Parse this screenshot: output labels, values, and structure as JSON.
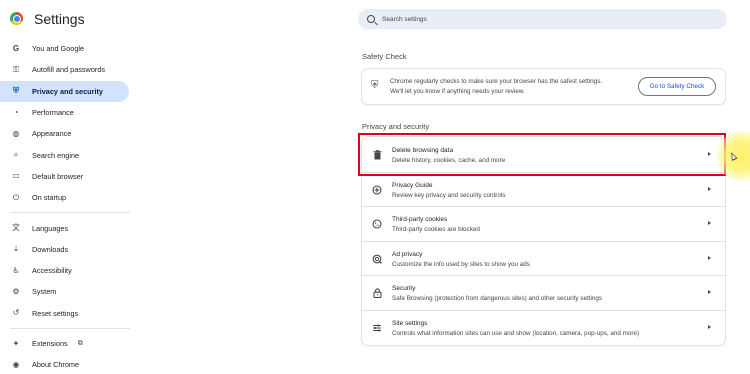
{
  "header": {
    "title": "Settings",
    "search_placeholder": "Search settings"
  },
  "sidebar": {
    "items": [
      {
        "label": "You and Google",
        "icon": "google-g-icon",
        "glyph": "G",
        "active": false
      },
      {
        "label": "Autofill and passwords",
        "icon": "key-icon",
        "glyph": "⚿",
        "active": false
      },
      {
        "label": "Privacy and security",
        "icon": "shield-icon",
        "glyph": "⛨",
        "active": true
      },
      {
        "label": "Performance",
        "icon": "speedometer-icon",
        "glyph": "◔",
        "active": false
      },
      {
        "label": "Appearance",
        "icon": "palette-icon",
        "glyph": "◍",
        "active": false
      },
      {
        "label": "Search engine",
        "icon": "search-icon",
        "glyph": "⌕",
        "active": false
      },
      {
        "label": "Default browser",
        "icon": "browser-window-icon",
        "glyph": "▭",
        "active": false
      },
      {
        "label": "On startup",
        "icon": "power-icon",
        "glyph": "⏻",
        "active": false
      }
    ],
    "items_secondary": [
      {
        "label": "Languages",
        "icon": "translate-icon",
        "glyph": "文",
        "active": false
      },
      {
        "label": "Downloads",
        "icon": "download-icon",
        "glyph": "⤓",
        "active": false
      },
      {
        "label": "Accessibility",
        "icon": "accessibility-icon",
        "glyph": "♿",
        "active": false
      },
      {
        "label": "System",
        "icon": "wrench-icon",
        "glyph": "⚙",
        "active": false
      },
      {
        "label": "Reset settings",
        "icon": "reset-icon",
        "glyph": "↺",
        "active": false
      }
    ],
    "extensions_label": "Extensions",
    "extensions_link_glyph": "⧉",
    "about_label": "About Chrome",
    "about_glyph": "◉"
  },
  "safety_check": {
    "section_title": "Safety Check",
    "icon_glyph": "⛨",
    "text_line1": "Chrome regularly checks to make sure your browser has the safest settings.",
    "text_line2": "We'll let you know if anything needs your review.",
    "button_label": "Go to Safety Check"
  },
  "privacy": {
    "section_title": "Privacy and security",
    "rows": [
      {
        "title": "Delete browsing data",
        "subtitle": "Delete history, cookies, cache, and more",
        "icon": "trash-icon",
        "glyph": "🗑"
      },
      {
        "title": "Privacy Guide",
        "subtitle": "Review key privacy and security controls",
        "icon": "privacy-guide-icon",
        "glyph": "⊕"
      },
      {
        "title": "Third-party cookies",
        "subtitle": "Third-party cookies are blocked",
        "icon": "cookie-icon",
        "glyph": "◕"
      },
      {
        "title": "Ad privacy",
        "subtitle": "Customize the info used by sites to show you ads",
        "icon": "ad-privacy-icon",
        "glyph": "◎"
      },
      {
        "title": "Security",
        "subtitle": "Safe Browsing (protection from dangerous sites) and other security settings",
        "icon": "lock-icon",
        "glyph": "🔒︎"
      },
      {
        "title": "Site settings",
        "subtitle": "Controls what information sites can use and show (location, camera, pop-ups, and more)",
        "icon": "sliders-icon",
        "glyph": "☰"
      }
    ]
  },
  "colors": {
    "accent": "#0b57d0",
    "active_nav_bg": "#d3e3fd",
    "highlight_border": "#e0001b",
    "cursor_glow": "#fdf05a"
  }
}
